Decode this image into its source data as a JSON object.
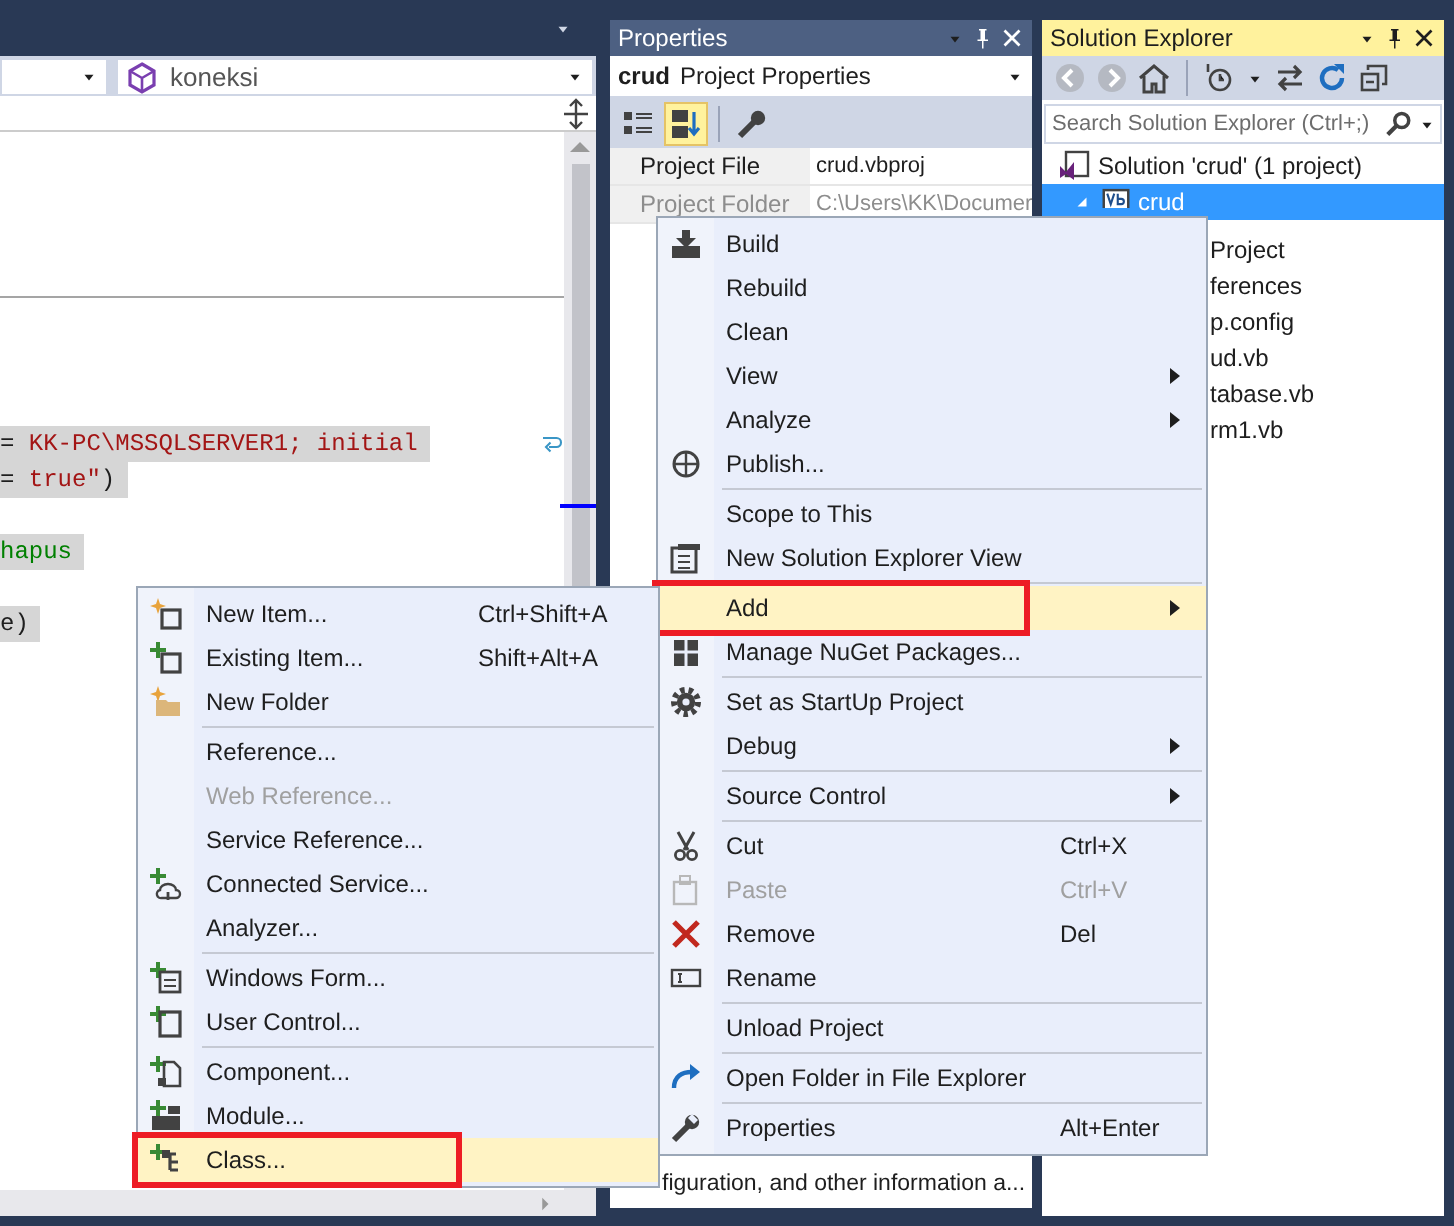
{
  "editor": {
    "member_dropdown": {
      "value": "koneksi"
    },
    "code_lines": [
      {
        "kind": "code",
        "tokens": [
          {
            "text": "= ",
            "kind": "plain"
          },
          {
            "text": "KK-PC\\MSSQLSERVER1; initial",
            "kind": "string"
          }
        ],
        "wrapped": true
      },
      {
        "kind": "code",
        "tokens": [
          {
            "text": "= ",
            "kind": "plain"
          },
          {
            "text": "true\"",
            "kind": "string"
          },
          {
            "text": ")",
            "kind": "plain"
          }
        ],
        "wrapped": false
      },
      {
        "kind": "blank"
      },
      {
        "kind": "code",
        "tokens": [
          {
            "text": "hapus",
            "kind": "comment"
          }
        ],
        "wrapped": false
      },
      {
        "kind": "blank"
      },
      {
        "kind": "code",
        "tokens": [
          {
            "text": "e)",
            "kind": "plain"
          }
        ]
      }
    ]
  },
  "properties": {
    "title": "Properties",
    "object_name": "crud",
    "object_type": "Project Properties",
    "toolbar": [
      {
        "selected": false
      },
      {
        "selected": true
      },
      {
        "selected": false
      }
    ],
    "rows": [
      {
        "name": "Project File",
        "value": "crud.vbproj",
        "disabled": false
      },
      {
        "name": "Project Folder",
        "value": "C:\\Users\\KK\\Documer",
        "disabled": true
      }
    ],
    "description": "figuration, and other information a..."
  },
  "solution_explorer": {
    "title": "Solution Explorer",
    "search": {
      "placeholder": "Search Solution Explorer (Ctrl+;)"
    },
    "tree": [
      {
        "label": "Solution 'crud' (1 project)",
        "selected": false,
        "children": [
          {
            "label": "crud",
            "selected": true,
            "expanded": true,
            "children": [
              {
                "label": "Project",
                "selected": false
              },
              {
                "label": "ferences",
                "selected": false
              },
              {
                "label": "p.config",
                "selected": false
              },
              {
                "label": "ud.vb",
                "selected": false
              },
              {
                "label": "tabase.vb",
                "selected": false
              },
              {
                "label": "rm1.vb",
                "selected": false
              }
            ]
          }
        ]
      }
    ]
  },
  "context_menu": {
    "items": [
      {
        "kind": "item",
        "label": "Build",
        "submenu": false,
        "disabled": false,
        "selected": false,
        "annotated": false
      },
      {
        "kind": "item",
        "label": "Rebuild",
        "submenu": false,
        "disabled": false,
        "selected": false,
        "annotated": false
      },
      {
        "kind": "item",
        "label": "Clean",
        "submenu": false,
        "disabled": false,
        "selected": false,
        "annotated": false
      },
      {
        "kind": "item",
        "label": "View",
        "submenu": true,
        "disabled": false,
        "selected": false,
        "annotated": false
      },
      {
        "kind": "item",
        "label": "Analyze",
        "submenu": true,
        "disabled": false,
        "selected": false,
        "annotated": false
      },
      {
        "kind": "item",
        "label": "Publish...",
        "submenu": false,
        "disabled": false,
        "selected": false,
        "annotated": false
      },
      {
        "kind": "separator"
      },
      {
        "kind": "item",
        "label": "Scope to This",
        "submenu": false,
        "disabled": false,
        "selected": false,
        "annotated": false
      },
      {
        "kind": "item",
        "label": "New Solution Explorer View",
        "submenu": false,
        "disabled": false,
        "selected": false,
        "annotated": false
      },
      {
        "kind": "separator"
      },
      {
        "kind": "item",
        "label": "Add",
        "submenu": true,
        "disabled": false,
        "selected": true,
        "annotated": true
      },
      {
        "kind": "item",
        "label": "Manage NuGet Packages...",
        "submenu": false,
        "disabled": false,
        "selected": false,
        "annotated": false
      },
      {
        "kind": "separator"
      },
      {
        "kind": "item",
        "label": "Set as StartUp Project",
        "submenu": false,
        "disabled": false,
        "selected": false,
        "annotated": false
      },
      {
        "kind": "item",
        "label": "Debug",
        "submenu": true,
        "disabled": false,
        "selected": false,
        "annotated": false
      },
      {
        "kind": "separator"
      },
      {
        "kind": "item",
        "label": "Source Control",
        "submenu": true,
        "disabled": false,
        "selected": false,
        "annotated": false
      },
      {
        "kind": "separator"
      },
      {
        "kind": "item",
        "label": "Cut",
        "shortcut": "Ctrl+X",
        "submenu": false,
        "disabled": false,
        "selected": false,
        "annotated": false
      },
      {
        "kind": "item",
        "label": "Paste",
        "shortcut": "Ctrl+V",
        "submenu": false,
        "disabled": true,
        "selected": false,
        "annotated": false
      },
      {
        "kind": "item",
        "label": "Remove",
        "shortcut": "Del",
        "submenu": false,
        "disabled": false,
        "selected": false,
        "annotated": false
      },
      {
        "kind": "item",
        "label": "Rename",
        "submenu": false,
        "disabled": false,
        "selected": false,
        "annotated": false
      },
      {
        "kind": "separator"
      },
      {
        "kind": "item",
        "label": "Unload Project",
        "submenu": false,
        "disabled": false,
        "selected": false,
        "annotated": false
      },
      {
        "kind": "separator"
      },
      {
        "kind": "item",
        "label": "Open Folder in File Explorer",
        "submenu": false,
        "disabled": false,
        "selected": false,
        "annotated": false
      },
      {
        "kind": "separator"
      },
      {
        "kind": "item",
        "label": "Properties",
        "shortcut": "Alt+Enter",
        "submenu": false,
        "disabled": false,
        "selected": false,
        "annotated": false
      }
    ]
  },
  "add_submenu": {
    "items": [
      {
        "kind": "item",
        "label": "New Item...",
        "shortcut": "Ctrl+Shift+A",
        "disabled": false,
        "selected": false,
        "annotated": false
      },
      {
        "kind": "item",
        "label": "Existing Item...",
        "shortcut": "Shift+Alt+A",
        "disabled": false,
        "selected": false,
        "annotated": false
      },
      {
        "kind": "item",
        "label": "New Folder",
        "disabled": false,
        "selected": false,
        "annotated": false
      },
      {
        "kind": "separator"
      },
      {
        "kind": "item",
        "label": "Reference...",
        "disabled": false,
        "selected": false,
        "annotated": false
      },
      {
        "kind": "item",
        "label": "Web Reference...",
        "disabled": true,
        "selected": false,
        "annotated": false
      },
      {
        "kind": "item",
        "label": "Service Reference...",
        "disabled": false,
        "selected": false,
        "annotated": false
      },
      {
        "kind": "item",
        "label": "Connected Service...",
        "disabled": false,
        "selected": false,
        "annotated": false
      },
      {
        "kind": "item",
        "label": "Analyzer...",
        "disabled": false,
        "selected": false,
        "annotated": false
      },
      {
        "kind": "separator"
      },
      {
        "kind": "item",
        "label": "Windows Form...",
        "disabled": false,
        "selected": false,
        "annotated": false
      },
      {
        "kind": "item",
        "label": "User Control...",
        "disabled": false,
        "selected": false,
        "annotated": false
      },
      {
        "kind": "separator"
      },
      {
        "kind": "item",
        "label": "Component...",
        "disabled": false,
        "selected": false,
        "annotated": false
      },
      {
        "kind": "item",
        "label": "Module...",
        "disabled": false,
        "selected": false,
        "annotated": false
      },
      {
        "kind": "item",
        "label": "Class...",
        "disabled": false,
        "selected": true,
        "annotated": true
      }
    ]
  }
}
